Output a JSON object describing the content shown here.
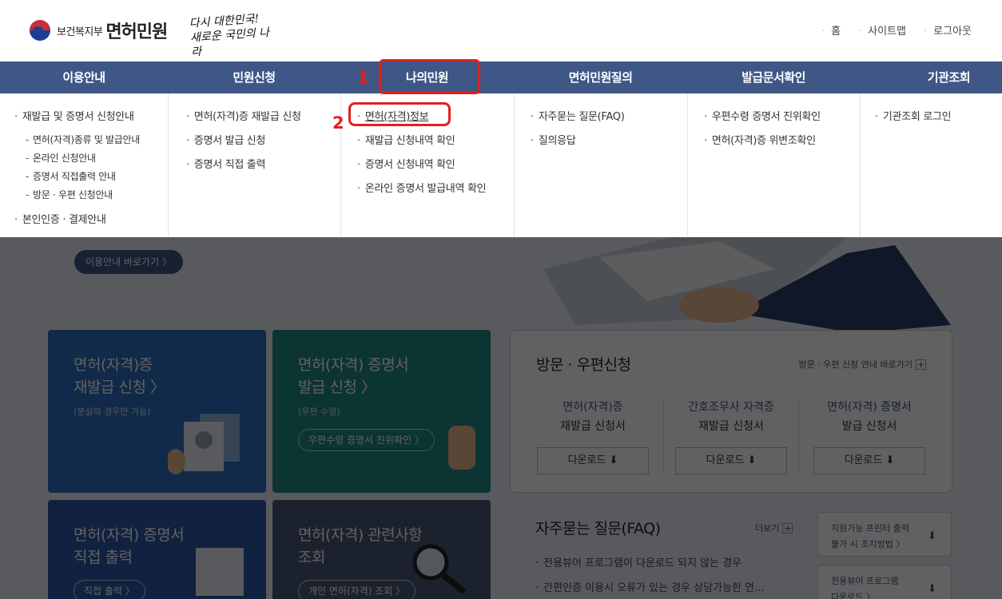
{
  "header": {
    "ministry": "보건복지부",
    "service": "면허민원",
    "slogan_line1": "다시 대한민국!",
    "slogan_line2": "새로운 국민의 나라",
    "util_links": [
      "홈",
      "사이트맵",
      "로그아웃"
    ]
  },
  "gnb": [
    "이용안내",
    "민원신청",
    "나의민원",
    "면허민원질의",
    "발급문서확인",
    "기관조회"
  ],
  "submenu": {
    "guide": [
      "재발급 및 증명서 신청안내",
      "면허(자격)종류 및 발급안내",
      "온라인 신청안내",
      "증명서 직접출력 안내",
      "방문 · 우편 신청안내",
      "본인인증 · 결제안내"
    ],
    "apply": [
      "면허(자격)증 재발급 신청",
      "증명서 발급 신청",
      "증명서 직접 출력"
    ],
    "my": [
      "면허(자격)정보",
      "재발급 신청내역 확인",
      "증명서 신청내역 확인",
      "온라인 증명서 발급내역 확인"
    ],
    "qna": [
      "자주묻는 질문(FAQ)",
      "질의응답"
    ],
    "verify": [
      "우편수령 증명서 진위확인",
      "면허(자격)증 위변조확인"
    ],
    "org": [
      "기관조회 로그인"
    ]
  },
  "annotations": [
    "1",
    "2"
  ],
  "main": {
    "guide_button": "이용안내 바로가기 〉",
    "card1_title1": "면허(자격)증",
    "card1_title2": "재발급 신청 〉",
    "card1_sub": "(분실의 경우만 가능)",
    "card2_title1": "면허(자격) 증명서",
    "card2_title2": "발급 신청 〉",
    "card2_sub": "(우편 수령)",
    "card2_pill": "우편수령 증명서 진위확인 〉",
    "card3_title1": "면허(자격) 증명서",
    "card3_title2": "직접 출력",
    "card3_pill": "직접 출력 〉",
    "card4_title1": "면허(자격) 관련사항",
    "card4_title2": "조회",
    "card4_pill": "개인 면허(자격) 조회 〉",
    "visit_title": "방문 · 우편신청",
    "visit_link": "방문 · 우편 신청 안내 바로가기",
    "forms": [
      {
        "l1": "면허(자격)증",
        "l2": "재발급 신청서"
      },
      {
        "l1": "간호조무사 자격증",
        "l2": "재발급 신청서"
      },
      {
        "l1": "면허(자격) 증명서",
        "l2": "발급 신청서"
      }
    ],
    "download": "다운로드 ⬇",
    "faq_title": "자주묻는 질문(FAQ)",
    "faq_more": "더보기",
    "faq_items": [
      "전용뷰어 프로그램이 다운로드 되지 않는 경우",
      "간편인증 이용시 오류가 있는 경우 상담가능한 연..."
    ],
    "side1_l1": "지원가능 프린터 출력",
    "side1_l2": "불가 시 조치방법 〉",
    "side2_l1": "전용뷰어 프로그램",
    "side2_l2": "다운로드 〉",
    "download_icon": "⬇"
  },
  "colors": {
    "nav": "#3e5786",
    "annotation": "#e02020"
  }
}
